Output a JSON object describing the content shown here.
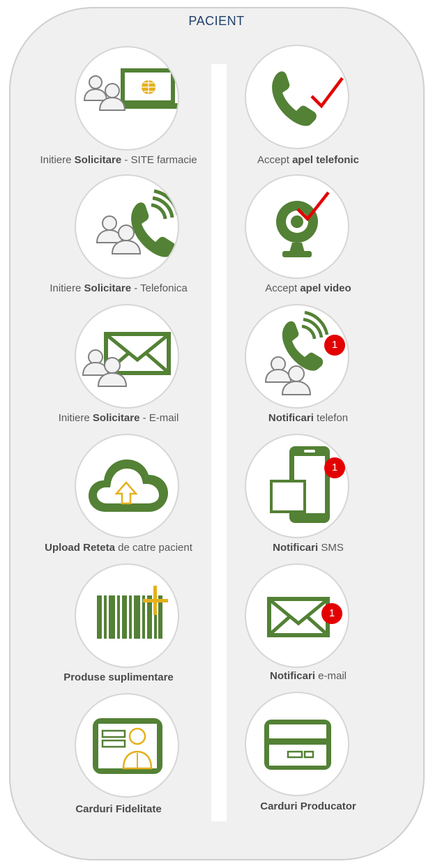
{
  "title": "PACIENT",
  "left": [
    {
      "pre": "Initiere ",
      "bold": "Solicitare",
      "post": "  - SITE farmacie"
    },
    {
      "pre": "Initiere ",
      "bold": "Solicitare",
      "post": "  - Telefonica"
    },
    {
      "pre": "Initiere ",
      "bold": "Solicitare",
      "post": " - E-mail"
    },
    {
      "pre": "",
      "bold": "Upload Reteta",
      "post": " de catre pacient"
    },
    {
      "pre": "",
      "bold": "Produse suplimentare",
      "post": ""
    },
    {
      "pre": "",
      "bold": "Carduri Fidelitate",
      "post": ""
    }
  ],
  "right": [
    {
      "pre": "Accept ",
      "bold": "apel telefonic",
      "post": ""
    },
    {
      "pre": "Accept ",
      "bold": "apel video",
      "post": ""
    },
    {
      "pre": "",
      "bold": "Notificari",
      "post": "  telefon"
    },
    {
      "pre": "",
      "bold": "Notificari",
      "post": " SMS"
    },
    {
      "pre": "",
      "bold": "Notificari",
      "post": " e-mail"
    },
    {
      "pre": "",
      "bold": "Carduri Producator",
      "post": ""
    }
  ],
  "badges": {
    "phone": "1",
    "sms": "1",
    "email": "1"
  },
  "colors": {
    "green": "#538135",
    "gold": "#e5b01c",
    "red": "#e30000",
    "gray": "#bfbfbf"
  }
}
